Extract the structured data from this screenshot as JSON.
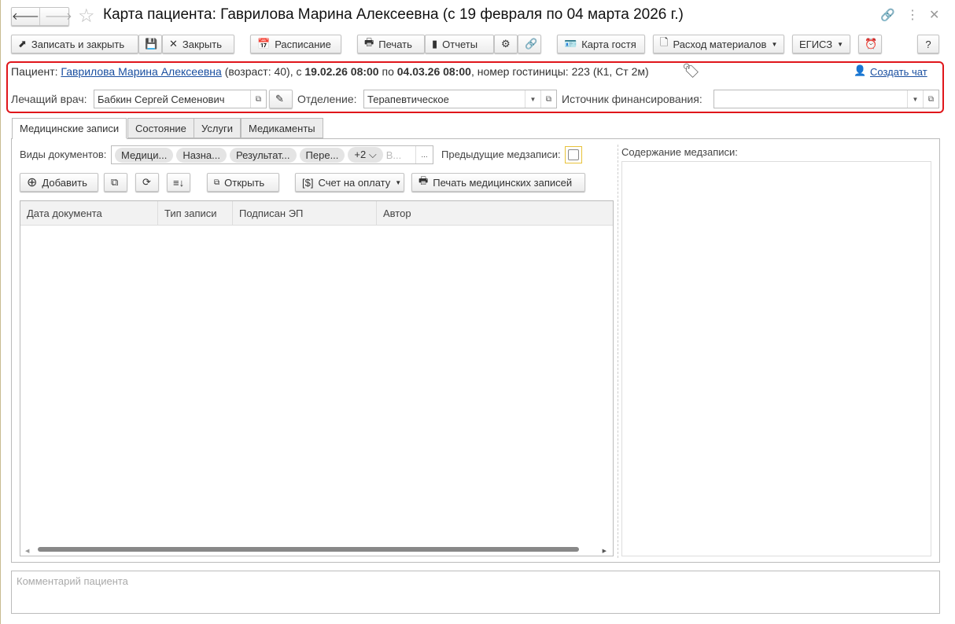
{
  "window": {
    "title": "Карта пациента: Гаврилова Марина Алексеевна (с 19 февраля по 04 марта 2026 г.)"
  },
  "toolbar": {
    "save_close": "Записать и закрыть",
    "close": "Закрыть",
    "schedule": "Расписание",
    "print": "Печать",
    "reports": "Отчеты",
    "guest_card": "Карта гостя",
    "materials": "Расход материалов",
    "egisz": "ЕГИСЗ",
    "help": "?"
  },
  "patient": {
    "label": "Пациент:",
    "name": "Гаврилова Марина Алексеевна",
    "age": "(возраст: 40), с",
    "from": "19.02.26 08:00",
    "by": "по",
    "to": "04.03.26 08:00",
    "hotel": ", номер гостиницы: 223 (К1, Ст 2м)",
    "create_chat": "Создать чат"
  },
  "fields": {
    "doctor_label": "Лечащий врач:",
    "doctor": "Бабкин Сергей Семенович",
    "dept_label": "Отделение:",
    "dept": "Терапевтическое",
    "fin_label": "Источник финансирования:",
    "fin": ""
  },
  "tabs": [
    "Медицинские записи",
    "Состояние",
    "Услуги",
    "Медикаменты"
  ],
  "records": {
    "doc_types_label": "Виды документов:",
    "chips": [
      "Медици...",
      "Назна...",
      "Результат...",
      "Пере...",
      "+2"
    ],
    "chip_more": "В...",
    "more": "...",
    "prev_label": "Предыдущие медзаписи:",
    "add": "Добавить",
    "open": "Открыть",
    "invoice": "Счет на оплату",
    "print_records": "Печать медицинских записей",
    "columns": [
      "Дата документа",
      "Тип записи",
      "Подписан ЭП",
      "Автор"
    ],
    "content_label": "Содержание медзаписи:"
  },
  "comment": {
    "placeholder": "Комментарий пациента"
  }
}
